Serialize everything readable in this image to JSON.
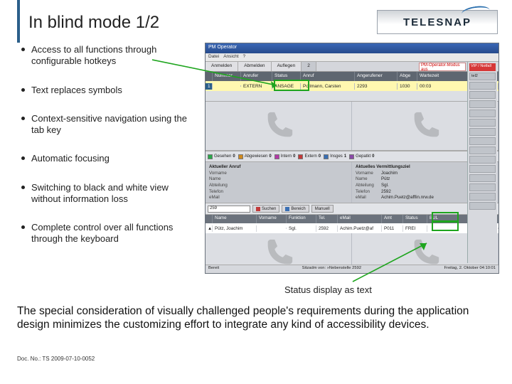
{
  "title": "In blind mode 1/2",
  "logo": "TELESNAP",
  "bullets": [
    "Access to all functions through configurable hotkeys",
    "Text replaces symbols",
    "Context-sensitive navigation using the tab key",
    "Automatic focusing",
    "Switching to black and white view without information loss",
    "Complete control over all functions through the keyboard"
  ],
  "caption": "Status display as text",
  "bottom": "The special consideration of visually challenged people's requirements during the application design minimizes the customizing effort to integrate any kind of accessibility devices.",
  "docno": "Doc. No.: TS 2009-07-10-0052",
  "ss": {
    "title": "PM Operator",
    "menu": [
      "Datei",
      "Ansicht",
      "?"
    ],
    "tabs": [
      "Anmelden",
      "Abmelden",
      "Auflegen",
      "2"
    ],
    "redtab": "PM-Operator-Modus aus",
    "head": [
      "",
      "Nummer",
      "Anrufer",
      "Status",
      "Anruf",
      "Angerufener",
      "Abge",
      "Wartezeit"
    ],
    "row0": [
      "1",
      "",
      "EXTERN",
      "ANSAGE",
      "Pollmann, Carsten",
      "2293",
      "",
      "1030",
      "00:03"
    ],
    "side": {
      "red": "VIP / Notfall",
      "t2": "tel2"
    },
    "counters": [
      {
        "c": "#2aa84a",
        "l": "Gesehen",
        "v": "0"
      },
      {
        "c": "#d08a1e",
        "l": "Abgewiesen",
        "v": "0"
      },
      {
        "c": "#b43aa8",
        "l": "Intern",
        "v": "0"
      },
      {
        "c": "#c23a3a",
        "l": "Extern",
        "v": "0"
      },
      {
        "c": "#3a6fb4",
        "l": "Insges",
        "v": "1"
      },
      {
        "c": "#8a4aa8",
        "l": "Gepatkt",
        "v": "0"
      }
    ],
    "det_left_title": "Aktueller Anruf",
    "det_right_title": "Aktuelles Vermittlungsziel",
    "det_left": [
      [
        "Vorname",
        ""
      ],
      [
        "Name",
        ""
      ],
      [
        "Abteilung",
        ""
      ],
      [
        "Telefon",
        ""
      ],
      [
        "eMail",
        ""
      ]
    ],
    "det_right": [
      [
        "Vorname",
        "Joachim"
      ],
      [
        "Name",
        "Pütz"
      ],
      [
        "Abteilung",
        "Sgl."
      ],
      [
        "Telefon",
        "2592"
      ],
      [
        "eMail",
        "Achim.Puetz@afflin.nrw.de"
      ]
    ],
    "search_input": "259",
    "sbtns": [
      {
        "c": "#c23a3a",
        "l": "Suchen"
      },
      {
        "c": "#3a6fb4",
        "l": "Bereich"
      },
      {
        "c": "",
        "l": "Manuell"
      }
    ],
    "listhead": [
      "",
      "Name",
      "Vorname",
      "Funktion",
      "Tel.",
      "eMail",
      "Amt",
      "Status",
      "BUL"
    ],
    "listrow": [
      "▲",
      "Pütz, Joachim",
      "",
      "Sgl.",
      "2592",
      "Achim.Puetz@af",
      "P011",
      "FREI",
      ""
    ],
    "statusbar_left": "Bereit",
    "statusbar_mid": "Sitzadm von: »Nebenstelle 2592",
    "statusbar_right": "Freitag, 2. Oktober   04:10:01"
  }
}
